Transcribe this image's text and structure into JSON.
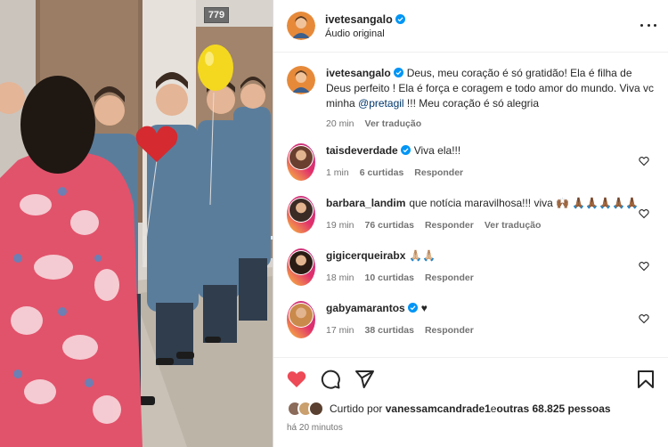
{
  "media": {
    "room_number": "779"
  },
  "post": {
    "author": "ivetesangalo",
    "audio": "Áudio original"
  },
  "caption": {
    "user": "ivetesangalo",
    "text_before": "Deus, meu coração é só gratidão! Ela é filha de Deus perfeito ! Ela é força e coragem e todo amor do mundo. Viva vc minha ",
    "mention": "@pretagil",
    "text_after": " !!! Meu coração é só alegria",
    "time": "20 min",
    "translate": "Ver tradução"
  },
  "comments": [
    {
      "user": "taisdeverdade",
      "verified": true,
      "text": "Viva ela!!!",
      "time": "1 min",
      "likes": "6 curtidas",
      "reply": "Responder",
      "translate": "",
      "avatar_color": "#6b3f2f"
    },
    {
      "user": "barbara_landim",
      "verified": false,
      "text": "que notícia maravilhosa!!! viva 🙌🏾 🙏🏾🙏🏾🙏🏾🙏🏾🙏🏾",
      "time": "19 min",
      "likes": "76 curtidas",
      "reply": "Responder",
      "translate": "Ver tradução",
      "avatar_color": "#3b2b25"
    },
    {
      "user": "gigicerqueirabx",
      "verified": false,
      "text": "🙏🏼🙏🏼",
      "time": "18 min",
      "likes": "10 curtidas",
      "reply": "Responder",
      "translate": "",
      "avatar_color": "#2a1c14"
    },
    {
      "user": "gabyamarantos",
      "verified": true,
      "text": "♥",
      "time": "17 min",
      "likes": "38 curtidas",
      "reply": "Responder",
      "translate": "",
      "avatar_color": "#c98a4b"
    }
  ],
  "likes": {
    "prefix": "Curtido por ",
    "user": "vanessamcandrade1",
    "middle": " e ",
    "others": "outras 68.825 pessoas"
  },
  "posted_ago": "há 20 minutos",
  "colors": {
    "like_red": "#ed4956",
    "verified_blue": "#0095f6",
    "mention": "#00376b",
    "muted": "#737373"
  },
  "icons": [
    "heart-icon",
    "comment-icon",
    "share-icon",
    "save-icon",
    "more-options-icon",
    "verified-icon"
  ]
}
